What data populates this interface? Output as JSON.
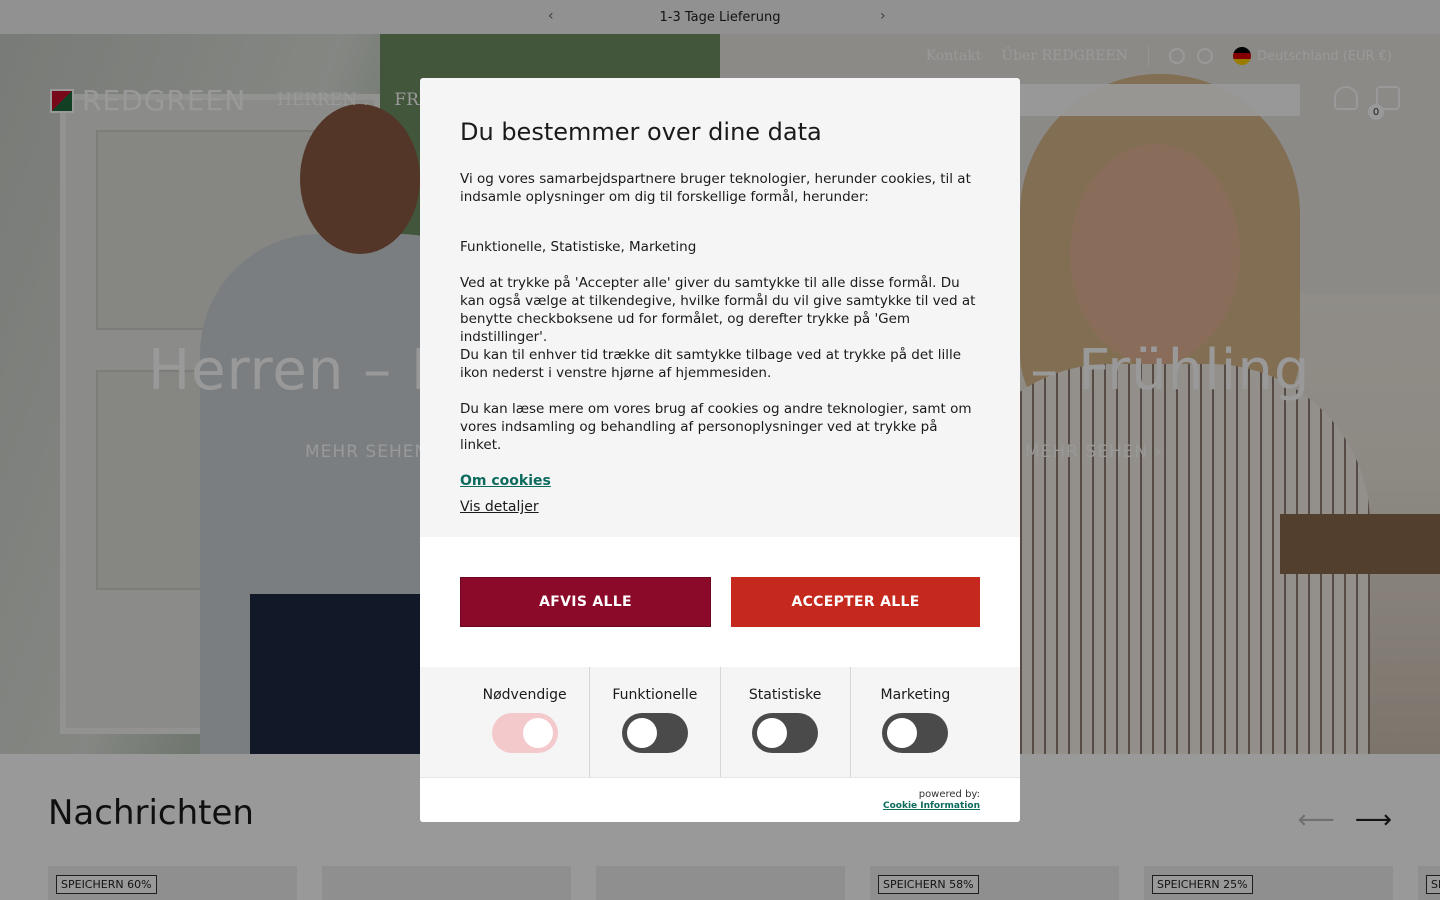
{
  "announcement": {
    "text": "1-3 Tage Lieferung",
    "prev_icon": "‹",
    "next_icon": "›"
  },
  "header": {
    "topnav": {
      "contact": "Kontakt",
      "about": "Über REDGREEN",
      "country": "Deutschland (EUR €)"
    },
    "logo_text": "REDGREEN",
    "mainnav": [
      {
        "label": "HERREN"
      },
      {
        "label": "FRA"
      }
    ],
    "search_placeholder": "n",
    "cart_count": "0"
  },
  "hero": {
    "left_title": "Herren – Fr",
    "right_title": "n – Frühling",
    "left_link": "MEHR SEHEN",
    "right_link": "MEHR SEHEN ›"
  },
  "news": {
    "title": "Nachrichten",
    "prev_icon": "⟵",
    "next_icon": "⟶",
    "cards": [
      {
        "tag": "SPEICHERN 60%"
      },
      {
        "tag": ""
      },
      {
        "tag": ""
      },
      {
        "tag": "SPEICHERN 58%"
      },
      {
        "tag": "SPEICHERN 25%"
      },
      {
        "tag": "SP"
      }
    ]
  },
  "cookie": {
    "title": "Du bestemmer over dine data",
    "intro": "Vi og vores samarbejdspartnere bruger teknologier, herunder cookies, til at indsamle oplysninger om dig til forskellige formål, herunder:",
    "purposes": "Funktionelle, Statistiske, Marketing",
    "consent1": "Ved at trykke på 'Accepter alle' giver du samtykke til alle disse formål. Du kan også vælge at tilkendegive, hvilke formål du vil give samtykke til ved at benytte checkboksene ud for formålet, og derefter trykke på 'Gem indstillinger'.",
    "consent2": "Du kan til enhver tid trække dit samtykke tilbage ved at trykke på det lille ikon nederst i venstre hjørne af hjemmesiden.",
    "more": "Du kan læse mere om vores brug af cookies og andre teknologier, samt om vores indsamling og behandling af personoplysninger ved at trykke på linket.",
    "about_link": "Om cookies",
    "details_link": "Vis detaljer",
    "reject_label": "AFVIS ALLE",
    "accept_label": "ACCEPTER ALLE",
    "toggles": [
      {
        "label": "Nødvendige",
        "on": true
      },
      {
        "label": "Funktionelle",
        "on": false
      },
      {
        "label": "Statistiske",
        "on": false
      },
      {
        "label": "Marketing",
        "on": false
      }
    ],
    "powered_by": "powered by:",
    "provider": "Cookie Information"
  },
  "colors": {
    "reject_bg": "#8b0a2a",
    "accept_bg": "#c5281c",
    "link_green": "#0d6b5e",
    "toggle_off": "#4a4a4a",
    "toggle_on": "#f3c9cc"
  }
}
